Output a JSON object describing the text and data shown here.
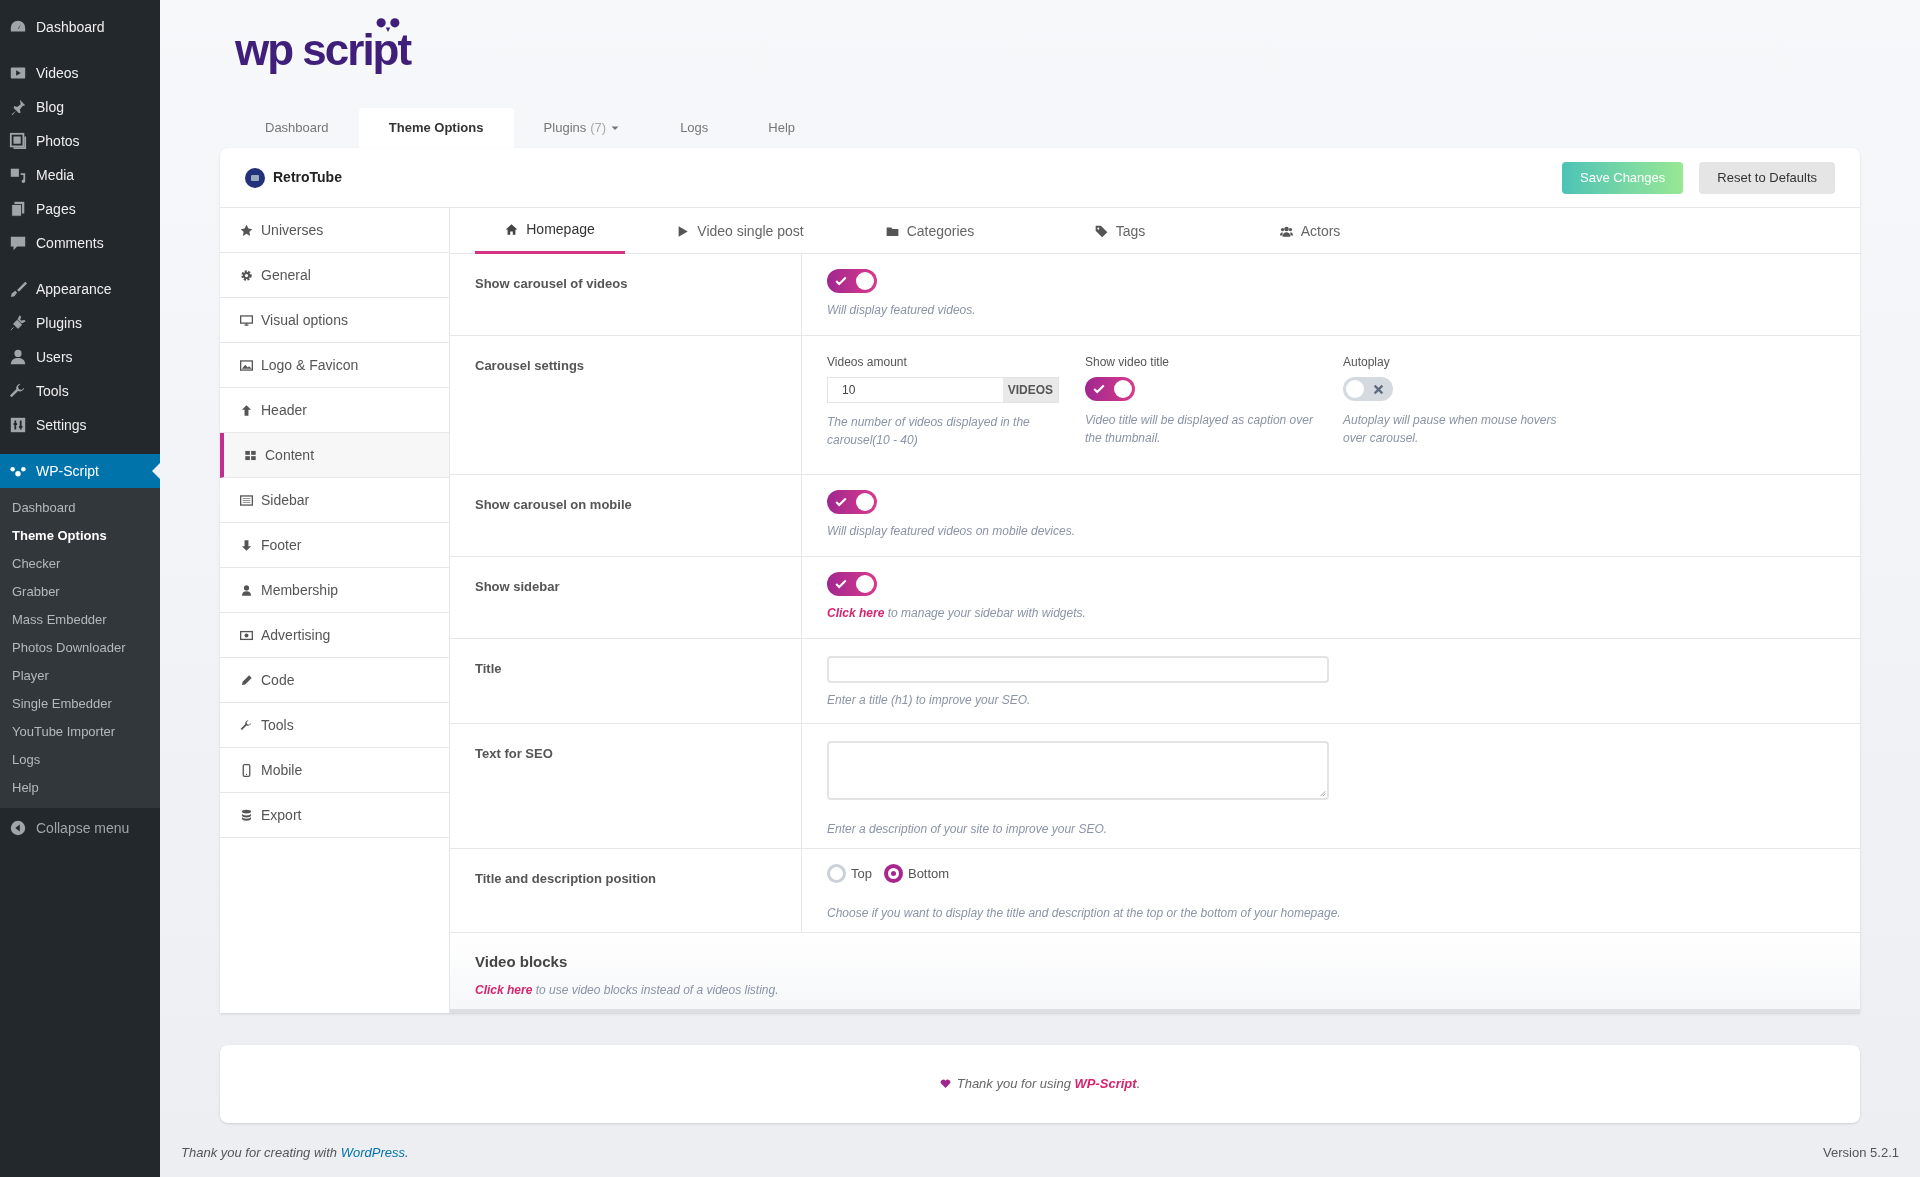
{
  "admin_menu": {
    "groups": [
      {
        "items": [
          {
            "label": "Dashboard",
            "selected": false
          }
        ]
      },
      {
        "items": [
          {
            "label": "Videos",
            "selected": false
          },
          {
            "label": "Blog",
            "selected": false
          },
          {
            "label": "Photos",
            "selected": false
          },
          {
            "label": "Media",
            "selected": false
          },
          {
            "label": "Pages",
            "selected": false
          },
          {
            "label": "Comments",
            "selected": false
          }
        ]
      },
      {
        "items": [
          {
            "label": "Appearance",
            "selected": false
          },
          {
            "label": "Plugins",
            "selected": false
          },
          {
            "label": "Users",
            "selected": false
          },
          {
            "label": "Tools",
            "selected": false
          },
          {
            "label": "Settings",
            "selected": false
          }
        ]
      },
      {
        "items": [
          {
            "label": "WP-Script",
            "selected": true
          }
        ]
      }
    ],
    "submenu": [
      {
        "label": "Dashboard",
        "selected": false
      },
      {
        "label": "Theme Options",
        "selected": true
      },
      {
        "label": "Checker",
        "selected": false
      },
      {
        "label": "Grabber",
        "selected": false
      },
      {
        "label": "Mass Embedder",
        "selected": false
      },
      {
        "label": "Photos Downloader",
        "selected": false
      },
      {
        "label": "Player",
        "selected": false
      },
      {
        "label": "Single Embedder",
        "selected": false
      },
      {
        "label": "YouTube Importer",
        "selected": false
      },
      {
        "label": "Logs",
        "selected": false
      },
      {
        "label": "Help",
        "selected": false
      }
    ],
    "collapse": "Collapse menu"
  },
  "logo": "wp script",
  "tabs": [
    {
      "label": "Dashboard",
      "selected": false,
      "has_menu": false
    },
    {
      "label": "Theme Options",
      "selected": true,
      "has_menu": false
    },
    {
      "label": "Plugins",
      "count": "(7)",
      "selected": false,
      "has_menu": true
    },
    {
      "label": "Logs",
      "selected": false,
      "has_menu": false
    },
    {
      "label": "Help",
      "selected": false,
      "has_menu": false
    }
  ],
  "theme": {
    "name": "RetroTube"
  },
  "buttons": [
    {
      "label": "Save Changes",
      "kind": "primary"
    },
    {
      "label": "Reset to Defaults",
      "kind": "secondary"
    }
  ],
  "sections": [
    {
      "label": "Universes",
      "selected": false
    },
    {
      "label": "General",
      "selected": false
    },
    {
      "label": "Visual options",
      "selected": false
    },
    {
      "label": "Logo & Favicon",
      "selected": false
    },
    {
      "label": "Header",
      "selected": false
    },
    {
      "label": "Content",
      "selected": true
    },
    {
      "label": "Sidebar",
      "selected": false
    },
    {
      "label": "Footer",
      "selected": false
    },
    {
      "label": "Membership",
      "selected": false
    },
    {
      "label": "Advertising",
      "selected": false
    },
    {
      "label": "Code",
      "selected": false
    },
    {
      "label": "Tools",
      "selected": false
    },
    {
      "label": "Mobile",
      "selected": false
    },
    {
      "label": "Export",
      "selected": false
    }
  ],
  "subtabs": [
    {
      "label": "Homepage",
      "selected": true
    },
    {
      "label": "Video single post",
      "selected": false
    },
    {
      "label": "Categories",
      "selected": false
    },
    {
      "label": "Tags",
      "selected": false
    },
    {
      "label": "Actors",
      "selected": false
    }
  ],
  "settings": [
    {
      "kind": "toggle",
      "label": "Show carousel of videos",
      "on": true,
      "help": "Will display featured videos."
    },
    {
      "kind": "group",
      "label": "Carousel settings",
      "fields": [
        {
          "kind": "number",
          "label": "Videos amount",
          "value": "10",
          "unit": "VIDEOS",
          "help": "The number of videos displayed in the carousel(10 - 40)"
        },
        {
          "kind": "toggle",
          "label": "Show video title",
          "on": true,
          "help": "Video title will be displayed as caption over the thumbnail."
        },
        {
          "kind": "toggle",
          "label": "Autoplay",
          "on": false,
          "help": "Autoplay will pause when mouse hovers over carousel."
        }
      ]
    },
    {
      "kind": "toggle",
      "label": "Show carousel on mobile",
      "on": true,
      "help": "Will display featured videos on mobile devices."
    },
    {
      "kind": "toggle",
      "label": "Show sidebar",
      "on": true,
      "help_link": "Click here",
      "help": "to manage your sidebar with widgets."
    },
    {
      "kind": "text",
      "label": "Title",
      "help": "Enter a title (h1) to improve your SEO."
    },
    {
      "kind": "textarea",
      "label": "Text for SEO",
      "help": "Enter a description of your site to improve your SEO."
    },
    {
      "kind": "radio",
      "label": "Title and description position",
      "options": [
        {
          "label": "Top",
          "selected": false
        },
        {
          "label": "Bottom",
          "selected": true
        }
      ],
      "help": "Choose if you want to display the title and description at the top or the bottom of your homepage."
    }
  ],
  "video_blocks": {
    "title": "Video blocks",
    "link": "Click here",
    "text": "to use video blocks instead of a videos listing."
  },
  "thanks": {
    "text": "Thank you for using",
    "link": "WP-Script",
    "after": "."
  },
  "footer": {
    "text": "Thank you for creating with",
    "link": "WordPress",
    "after": ".",
    "version": "Version 5.2.1"
  }
}
